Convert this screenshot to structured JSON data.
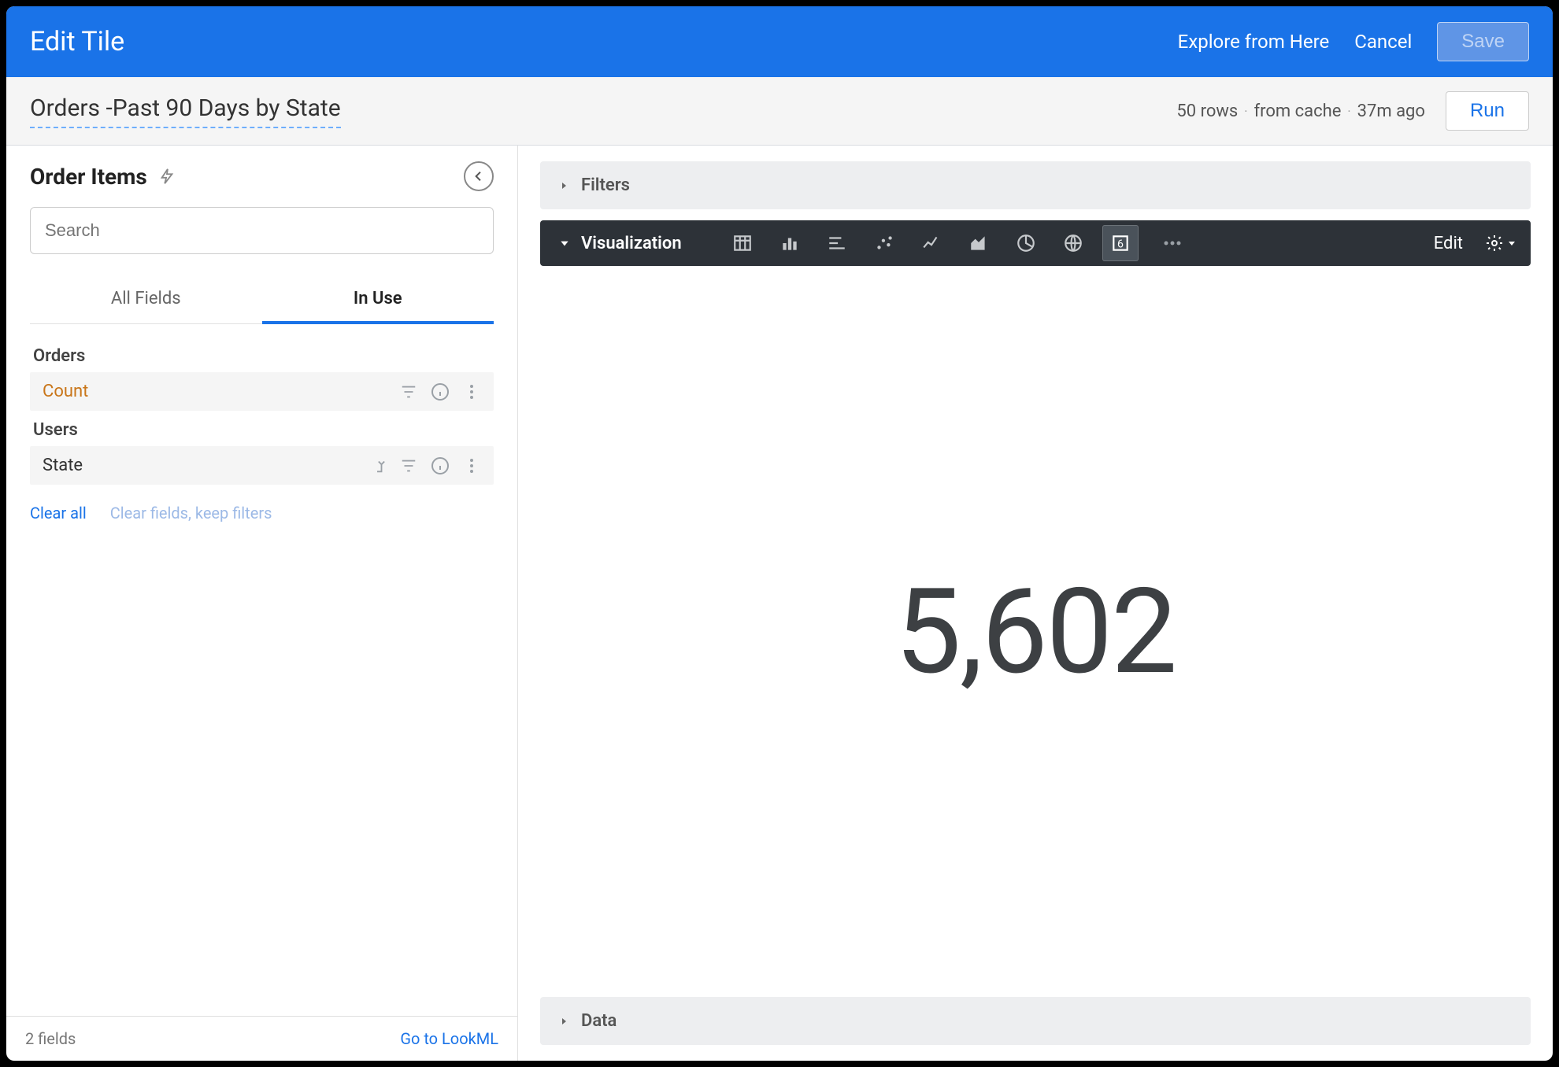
{
  "header": {
    "title": "Edit Tile",
    "explore": "Explore from Here",
    "cancel": "Cancel",
    "save": "Save"
  },
  "tile": {
    "title": "Orders -Past 90 Days by State",
    "rows": "50 rows",
    "cache": "from cache",
    "age": "37m ago",
    "run": "Run"
  },
  "sidebar": {
    "explore_name": "Order Items",
    "search_placeholder": "Search",
    "tabs": {
      "all": "All Fields",
      "inuse": "In Use"
    },
    "groups": {
      "orders": {
        "label": "Orders",
        "field": "Count"
      },
      "users": {
        "label": "Users",
        "field": "State"
      }
    },
    "clear_all": "Clear all",
    "clear_fields": "Clear fields, keep filters",
    "footer_count": "2 fields",
    "footer_lookml": "Go to LookML"
  },
  "panels": {
    "filters": "Filters",
    "visualization": "Visualization",
    "data": "Data",
    "edit": "Edit"
  },
  "viz_icons": {
    "table": "table-icon",
    "bar": "bar-chart-icon",
    "column": "column-chart-icon",
    "scatter": "scatter-icon",
    "line": "line-chart-icon",
    "area": "area-chart-icon",
    "pie": "pie-chart-icon",
    "map": "map-icon",
    "single": "single-value-icon",
    "more": "more-icon"
  },
  "visualization": {
    "value": "5,602"
  }
}
